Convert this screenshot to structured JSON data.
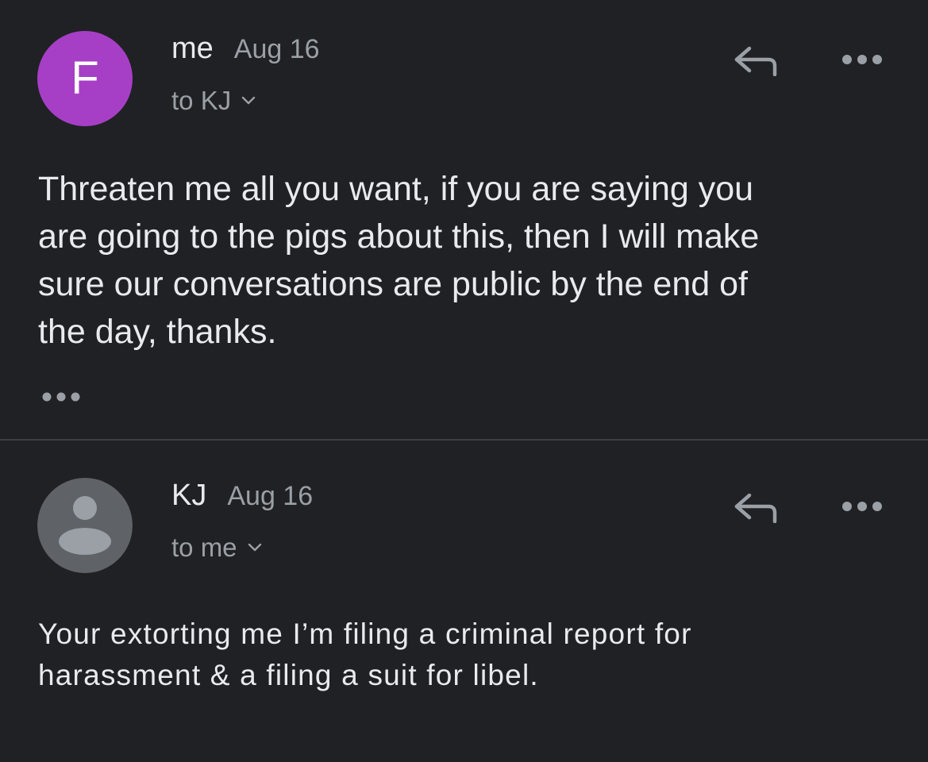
{
  "thread": {
    "messages": [
      {
        "sender": "me",
        "date": "Aug 16",
        "recipient_text": "to KJ",
        "avatar": {
          "kind": "letter",
          "letter": "F",
          "color": "#a63fc6"
        },
        "body": "Threaten me all you want, if you are saying you\nare going to the pigs about this, then I will make\nsure our conversations are public by the end of\nthe day, thanks.",
        "has_trimmed_content": true,
        "icons": [
          "reply-icon",
          "more-icon",
          "chevron-down-icon",
          "trimmed-content-icon"
        ]
      },
      {
        "sender": "KJ",
        "date": "Aug 16",
        "recipient_text": "to me",
        "avatar": {
          "kind": "person-placeholder",
          "color": "#5f6368",
          "glyph_color": "#9aa0a6"
        },
        "body": "Your extorting me I’m filing a criminal report for\nharassment & a filing a suit for libel.",
        "icons": [
          "reply-icon",
          "more-icon",
          "chevron-down-icon",
          "person-icon"
        ]
      }
    ]
  },
  "colors": {
    "background": "#202124",
    "primary_text": "#e8eaed",
    "secondary_text": "#9aa0a6",
    "divider": "#3c3d40"
  }
}
